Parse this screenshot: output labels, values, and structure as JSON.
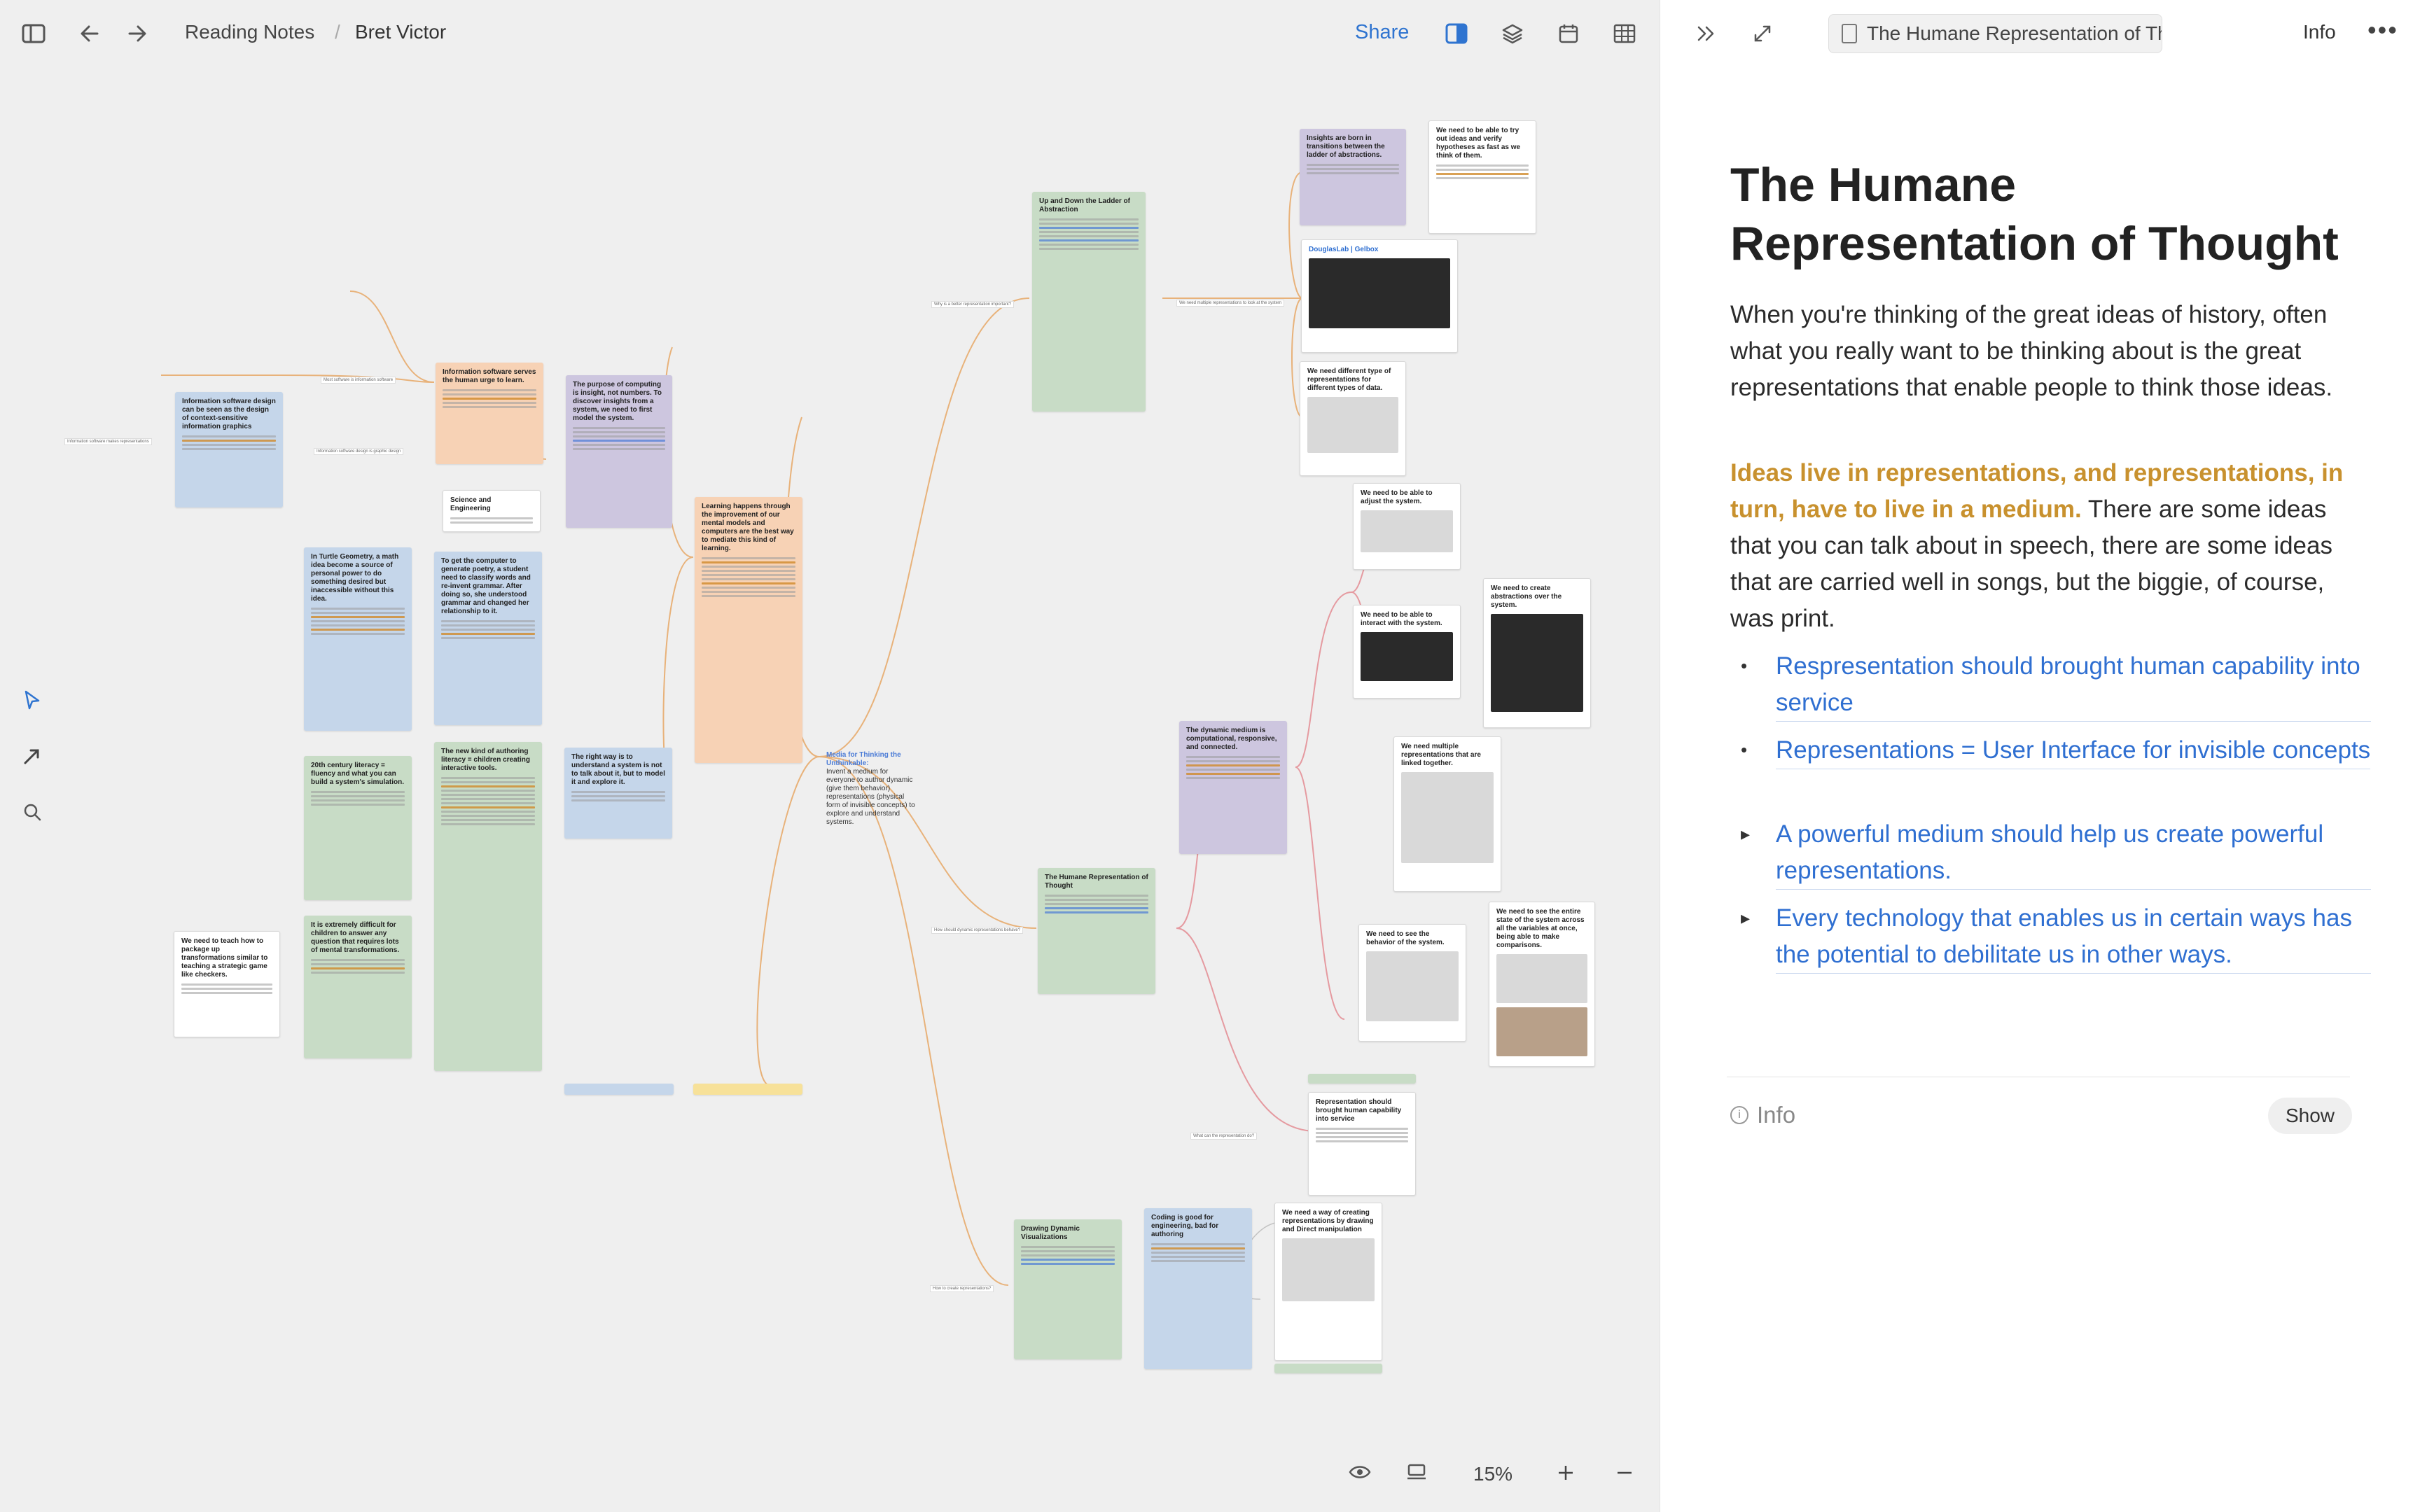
{
  "header": {
    "breadcrumb": [
      "Reading Notes",
      "Bret Victor"
    ],
    "share_label": "Share",
    "icons": [
      "sidebar-toggle-icon",
      "back-arrow-icon",
      "forward-arrow-icon",
      "split-view-icon",
      "layers-icon",
      "calendar-icon",
      "grid-icon"
    ]
  },
  "left_tools": [
    "pointer-icon",
    "connector-arrow-icon",
    "search-icon"
  ],
  "bottom_bar": {
    "zoom": "15%",
    "icons": [
      "eye-icon",
      "frame-icon",
      "zoom-in-icon",
      "zoom-out-icon"
    ]
  },
  "canvas": {
    "center_node": {
      "title": "Media for Thinking the Unthinkable:",
      "body": "Invent a medium for everyone to author dynamic (give them behavior) representations (physical form of invisible concepts) to explore and understand systems."
    },
    "cards": [
      {
        "id": "c1",
        "color": "blue",
        "title": "Information software design can be seen as the design of context-sensitive information graphics"
      },
      {
        "id": "c2",
        "color": "orange",
        "title": "Information software serves the human urge to learn."
      },
      {
        "id": "c3",
        "color": "purple",
        "title": "The purpose of computing is insight, not numbers. To discover insights from a system, we need to first model the system."
      },
      {
        "id": "c4",
        "color": "white",
        "title": "Science and Engineering"
      },
      {
        "id": "c5",
        "color": "blue",
        "title": "In Turtle Geometry, a math idea become a source of personal power to do something desired but inaccessible without this idea."
      },
      {
        "id": "c6",
        "color": "blue",
        "title": "To get the computer to generate poetry, a student need to classify words and re-invent grammar. After doing so, she understood grammar and changed her relationship to it."
      },
      {
        "id": "c7",
        "color": "orange",
        "title": "Learning happens through the improvement of our mental models and computers are the best way to mediate this kind of learning."
      },
      {
        "id": "c8",
        "color": "green",
        "title": "20th century literacy = fluency and what you can build a system's simulation."
      },
      {
        "id": "c9",
        "color": "green",
        "title": "The new kind of authoring literacy = children creating interactive tools."
      },
      {
        "id": "c10",
        "color": "blue",
        "title": "The right way is to understand a system is not to talk about it, but to model it and explore it."
      },
      {
        "id": "c11",
        "color": "green",
        "title": "It is extremely difficult for children to answer any question that requires lots of mental transformations."
      },
      {
        "id": "c12",
        "color": "white",
        "title": "We need to teach how to package up transformations similar to teaching a strategic game like checkers."
      },
      {
        "id": "c13",
        "color": "green",
        "title": "Up and Down the Ladder of Abstraction"
      },
      {
        "id": "c14",
        "color": "purple",
        "title": "Insights are born in transitions between the ladder of abstractions."
      },
      {
        "id": "c15",
        "color": "white",
        "title": "We need to be able to try out ideas and verify hypotheses as fast as we think of them."
      },
      {
        "id": "c16",
        "color": "white",
        "title": "DouglasLab | Gelbox"
      },
      {
        "id": "c17",
        "color": "white",
        "title": "We need different type of representations for different types of data."
      },
      {
        "id": "c18",
        "color": "white",
        "title": "We need to be able to adjust the system."
      },
      {
        "id": "c19",
        "color": "white",
        "title": "We need to be able to interact with the system."
      },
      {
        "id": "c20",
        "color": "white",
        "title": "We need to create abstractions over the system."
      },
      {
        "id": "c21",
        "color": "purple",
        "title": "The dynamic medium is computational, responsive, and connected."
      },
      {
        "id": "c22",
        "color": "white",
        "title": "We need multiple representations that are linked together."
      },
      {
        "id": "c23",
        "color": "green",
        "title": "The Humane Representation of Thought"
      },
      {
        "id": "c24",
        "color": "white",
        "title": "We need to see the behavior of the system."
      },
      {
        "id": "c25",
        "color": "white",
        "title": "We need to see the entire state of the system across all the variables at once, being able to make comparisons."
      },
      {
        "id": "c26",
        "color": "white",
        "title": "Representation should brought human capability into service"
      },
      {
        "id": "c27",
        "color": "green",
        "title": "Drawing Dynamic Visualizations"
      },
      {
        "id": "c28",
        "color": "blue",
        "title": "Coding is good for engineering, bad for authoring"
      },
      {
        "id": "c29",
        "color": "white",
        "title": "We need a way of creating representations by drawing and Direct manipulation"
      }
    ]
  },
  "panel": {
    "doc_pill": "The Humane Representation of Tho...",
    "info_tab": "Info",
    "more": "•••",
    "title": "The Humane Representation of Thought",
    "para1": "When you're thinking of the great ideas of history, often what you really want to be thinking about is the great representations that enable people to think those ideas.",
    "para2_highlight": "Ideas live in representations, and representations, in turn, have to live in a medium.",
    "para2_rest": " There are some ideas that you can talk about in speech, there are some ideas that are carried well in songs, but the biggie, of course, was print.",
    "bullets": [
      {
        "marker": "•",
        "text": "Respresentation should brought human capability into service"
      },
      {
        "marker": "•",
        "text": "Representations = User Interface for invisible concepts"
      },
      {
        "marker": "▸",
        "text": "A powerful medium should help us create powerful representations."
      },
      {
        "marker": "▸",
        "text": "Every technology that enables us in certain ways has the potential to debilitate us in other ways."
      }
    ],
    "info_label": "Info",
    "show_button": "Show",
    "icons": [
      "collapse-panel-icon",
      "expand-icon",
      "document-icon",
      "info-circle-icon"
    ]
  }
}
